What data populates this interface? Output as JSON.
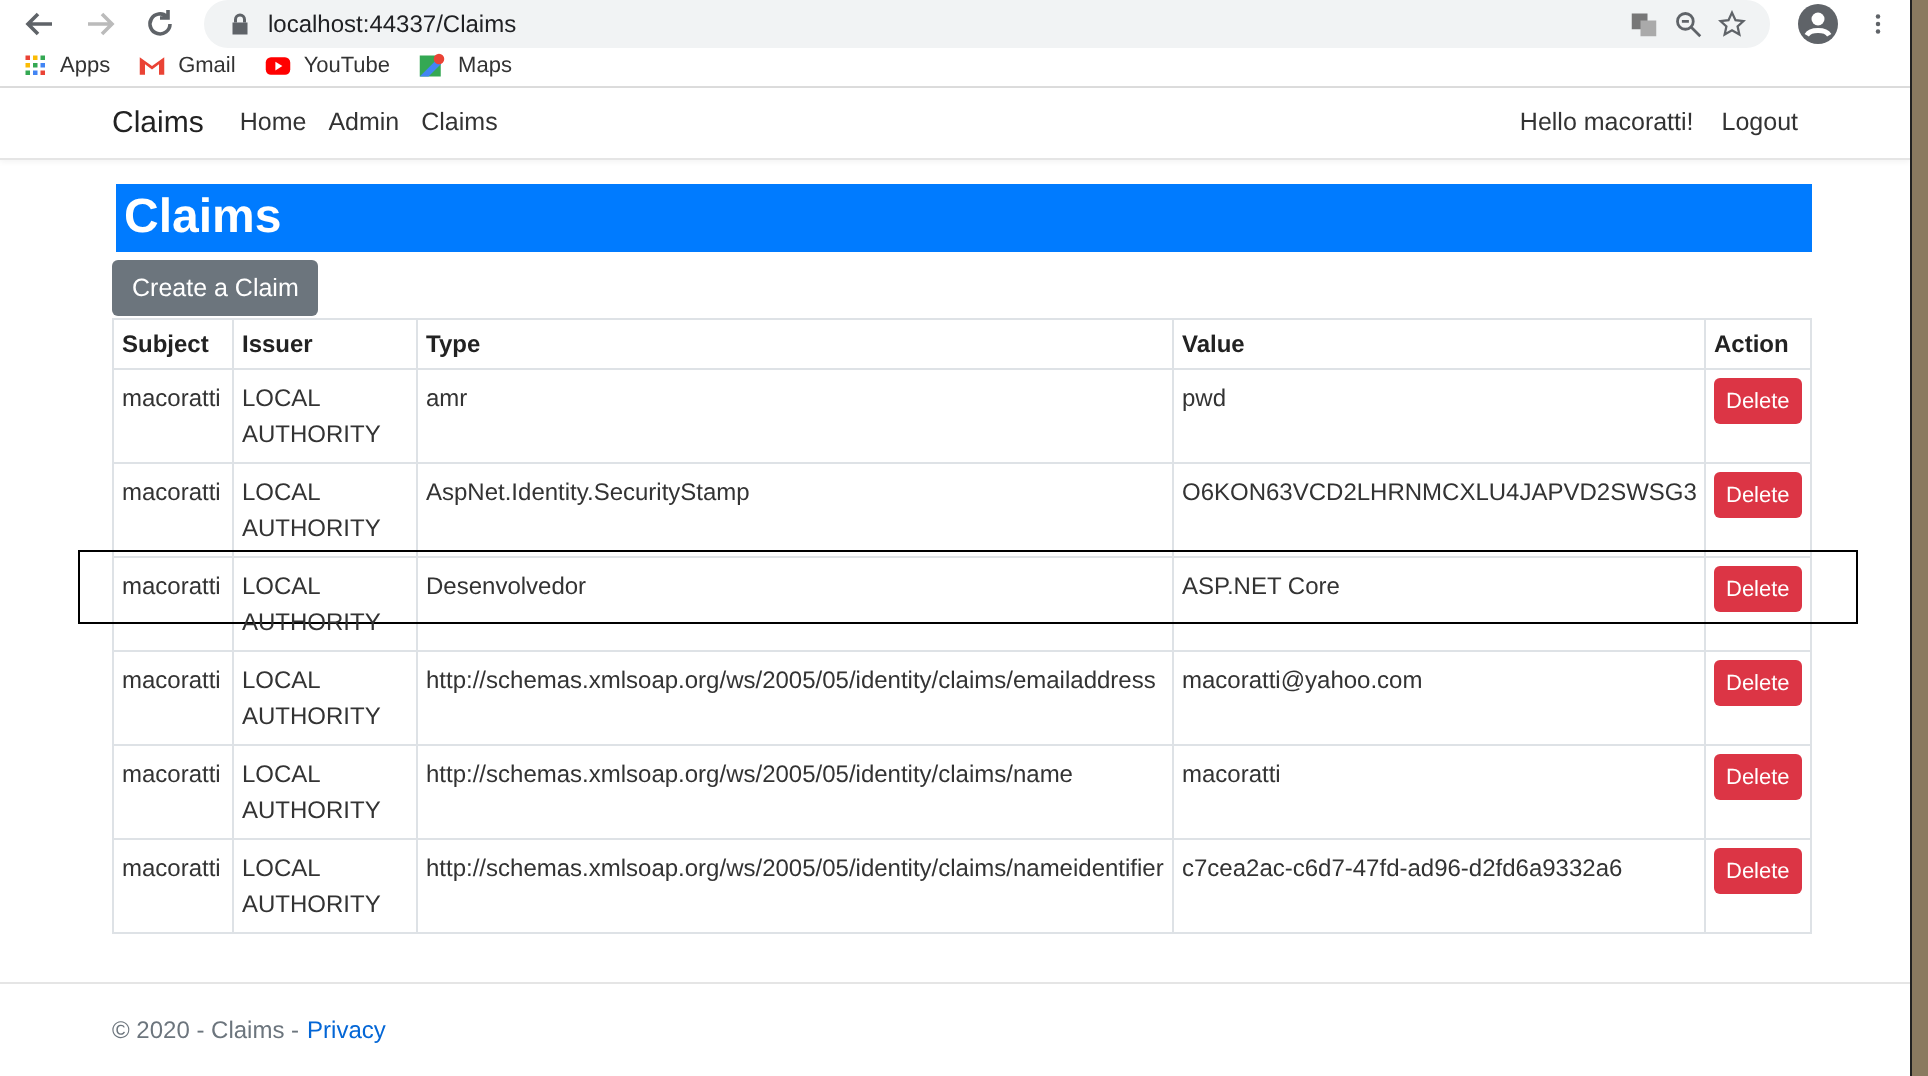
{
  "browser": {
    "url": "localhost:44337/Claims",
    "bookmarks": [
      {
        "label": "Apps",
        "kind": "apps"
      },
      {
        "label": "Gmail",
        "kind": "gmail"
      },
      {
        "label": "YouTube",
        "kind": "youtube"
      },
      {
        "label": "Maps",
        "kind": "maps"
      }
    ]
  },
  "navbar": {
    "brand": "Claims",
    "links": [
      "Home",
      "Admin",
      "Claims"
    ],
    "greeting": "Hello macoratti!",
    "logout": "Logout"
  },
  "page": {
    "title": "Claims",
    "create_button": "Create a Claim"
  },
  "table": {
    "columns": [
      "Subject",
      "Issuer",
      "Type",
      "Value",
      "Action"
    ],
    "rows": [
      {
        "subject": "macoratti",
        "issuer": "LOCAL AUTHORITY",
        "type": "amr",
        "value": "pwd",
        "action": "Delete",
        "highlighted": false
      },
      {
        "subject": "macoratti",
        "issuer": "LOCAL AUTHORITY",
        "type": "AspNet.Identity.SecurityStamp",
        "value": "O6KON63VCD2LHRNMCXLU4JAPVD2SWSG3",
        "action": "Delete",
        "highlighted": false
      },
      {
        "subject": "macoratti",
        "issuer": "LOCAL AUTHORITY",
        "type": "Desenvolvedor",
        "value": "ASP.NET Core",
        "action": "Delete",
        "highlighted": true
      },
      {
        "subject": "macoratti",
        "issuer": "LOCAL AUTHORITY",
        "type": "http://schemas.xmlsoap.org/ws/2005/05/identity/claims/emailaddress",
        "value": "macoratti@yahoo.com",
        "action": "Delete",
        "highlighted": false
      },
      {
        "subject": "macoratti",
        "issuer": "LOCAL AUTHORITY",
        "type": "http://schemas.xmlsoap.org/ws/2005/05/identity/claims/name",
        "value": "macoratti",
        "action": "Delete",
        "highlighted": false
      },
      {
        "subject": "macoratti",
        "issuer": "LOCAL AUTHORITY",
        "type": "http://schemas.xmlsoap.org/ws/2005/05/identity/claims/nameidentifier",
        "value": "c7cea2ac-c6d7-47fd-ad96-d2fd6a9332a6",
        "action": "Delete",
        "highlighted": false
      }
    ]
  },
  "footer": {
    "text": "© 2020 - Claims -",
    "link": "Privacy"
  }
}
